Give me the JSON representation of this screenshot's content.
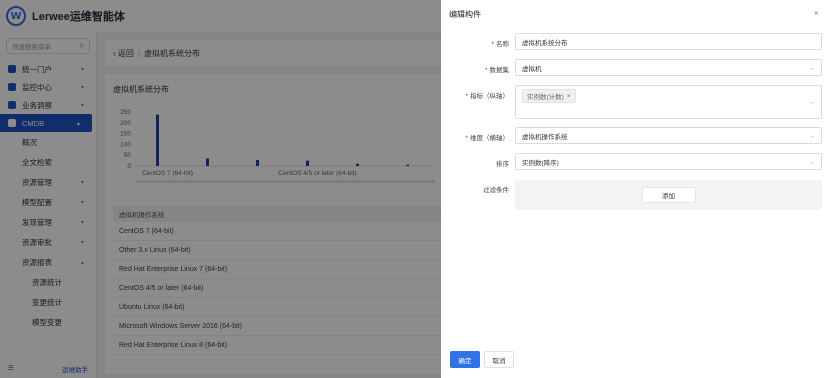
{
  "app": {
    "logo_letter": "W",
    "title": "Lerwee运维智能体"
  },
  "sidebar": {
    "search_placeholder": "快速搜索菜单",
    "menu": [
      {
        "label": "统一门户"
      },
      {
        "label": "监控中心"
      },
      {
        "label": "业务洞察"
      },
      {
        "label": "CMDB"
      }
    ],
    "cmdb_children": [
      {
        "label": "概况"
      },
      {
        "label": "全文检索"
      },
      {
        "label": "资源管理"
      },
      {
        "label": "模型配置"
      },
      {
        "label": "发现管理"
      },
      {
        "label": "资源审批"
      },
      {
        "label": "资源报表"
      }
    ],
    "report_children": [
      {
        "label": "资源统计"
      },
      {
        "label": "变更统计"
      },
      {
        "label": "模型变更"
      }
    ],
    "footer_right": "运维助手"
  },
  "main": {
    "breadcrumb_back": "返回",
    "breadcrumb_current": "虚拟机系统分布",
    "panel_title": "虚拟机系统分布",
    "table_header": "虚拟机操作系统",
    "table_rows": [
      "CentOS 7 (64-bit)",
      "Other 3.x Linux (64-bit)",
      "Red Hat Enterprise Linux 7 (64-bit)",
      "CentOS 4/5 or later (64-bit)",
      "Ubuntu Linux (64-bit)",
      "Microsoft Windows Server 2016 (64-bit)",
      "Red Hat Enterprise Linux 8 (64-bit)"
    ]
  },
  "chart_data": {
    "type": "bar",
    "categories": [
      "CentOS 7 (64-bit)",
      "",
      "",
      "CentOS 4/5 or later (64-bit)",
      "",
      ""
    ],
    "x_tick_labels": [
      "CentOS 7 (64-bit)",
      "CentOS 4/5 or later (64-bit)"
    ],
    "values": [
      238,
      35,
      28,
      25,
      10,
      6
    ],
    "yticks": [
      "250",
      "200",
      "150",
      "100",
      "50",
      "0"
    ],
    "ylim": [
      0,
      250
    ],
    "color": "#1d3fa6"
  },
  "drawer": {
    "title": "编辑构件",
    "close": "×",
    "fields": {
      "name_label": "名称",
      "name_value": "虚拟机系统分布",
      "dataset_label": "数据集",
      "dataset_value": "虚拟机",
      "metric_label": "指标（纵轴）",
      "metric_tag": "实例数(计数)",
      "metric_tag_close": "×",
      "dimension_label": "维度（横轴）",
      "dimension_value": "虚拟机操作系统",
      "sort_label": "排序",
      "sort_value": "实例数(降序)",
      "filter_label": "过滤条件",
      "add_button": "添加"
    },
    "ok_button": "确定",
    "cancel_button": "取消"
  },
  "colors": {
    "primary": "#2f74e6",
    "required": "#e02424",
    "sidebar_active": "#1d54c4"
  }
}
